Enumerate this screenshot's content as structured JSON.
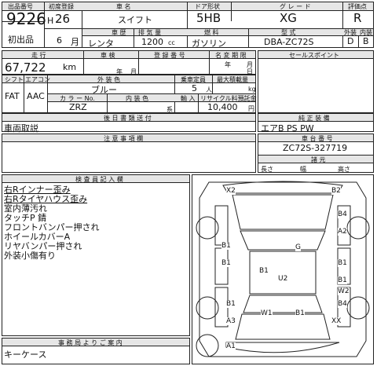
{
  "header": {
    "lot_no_label": "出品番号",
    "lot_no": "9226",
    "first_reg_label": "初度登録",
    "era": "H",
    "year": "26",
    "month": "6",
    "month_unit": "月",
    "car_name_label": "車 名",
    "car_name": "スイフト",
    "door_label": "ドア形状",
    "door": "5HB",
    "grade_label": "グ レ ー ド",
    "grade": "XG",
    "score_label": "評価点",
    "score": "R",
    "first_listing": "初出品",
    "use_label": "車 歴",
    "use": "レンタ",
    "cc_label": "排 気 量",
    "cc": "1200",
    "cc_unit": "cc",
    "fuel_label": "燃 料",
    "fuel": "ガソリン",
    "model_label": "型 式",
    "model": "DBA-ZC72S",
    "ext_label": "外装",
    "int_label": "内装",
    "ext": "D",
    "int": "B"
  },
  "row2": {
    "mileage_label": "走 行",
    "mileage": "67,722",
    "mileage_unit": "km",
    "inspection_label": "車 検",
    "year_unit": "年",
    "month_unit": "月",
    "reg_no_label": "登 録 番 号",
    "owner_label": "名 変 期 限",
    "owner_year": "年",
    "owner_month": "月",
    "owner_day": "日",
    "sales_point_label": "セールスポイント"
  },
  "row3": {
    "shift_label": "シフト",
    "ac_label": "エアコン",
    "color_label": "外 装 色",
    "capacity_label": "乗車定員",
    "load_label": "最大積載量",
    "shift": "FAT",
    "ac": "AAC",
    "color": "ブルー",
    "capacity": "5",
    "capacity_unit": "人",
    "load_unit": "kg",
    "color_no_label": "カ ラ ー No.",
    "interior_color_label": "内 装 色",
    "import_label": "輸 入",
    "recycle_label": "リサイクル料預託金",
    "color_no": "ZRZ",
    "import_unit": "系",
    "recycle_fee": "10,400",
    "recycle_unit": "円"
  },
  "equipment": {
    "parts_label": "後 日 書 類 送 付",
    "parts": "車両取説",
    "genuine_label": "純 正 装 備",
    "genuine": "エアB PS PW"
  },
  "notes": {
    "notes_label": "注 意 事 項 欄",
    "chassis_label": "車 台 番 号",
    "chassis": "ZC72S-327719",
    "dims_label": "諸 元",
    "len_label": "長さ",
    "width_label": "幅",
    "height_label": "高さ"
  },
  "inspector": {
    "label": "検 査 員 記 入 欄",
    "lines": [
      "右Rインナー歪み",
      "右Rタイヤハウス歪み",
      "室内薄汚れ",
      "タッチP 錆",
      "フロントバンパー押され",
      "ホイールカバーA",
      "リヤバンパー押され",
      "外装小傷有り"
    ]
  },
  "office": {
    "label": "事 務 局 よ り ご 案 内",
    "text": "キーケース"
  },
  "diagram_marks": [
    "X2",
    "B2",
    "B4",
    "A2",
    "G",
    "B1",
    "B1",
    "U2",
    "B1",
    "B1",
    "W2",
    "B1",
    "A3",
    "W1",
    "B1",
    "XX",
    "A1",
    "B4",
    "B1"
  ]
}
